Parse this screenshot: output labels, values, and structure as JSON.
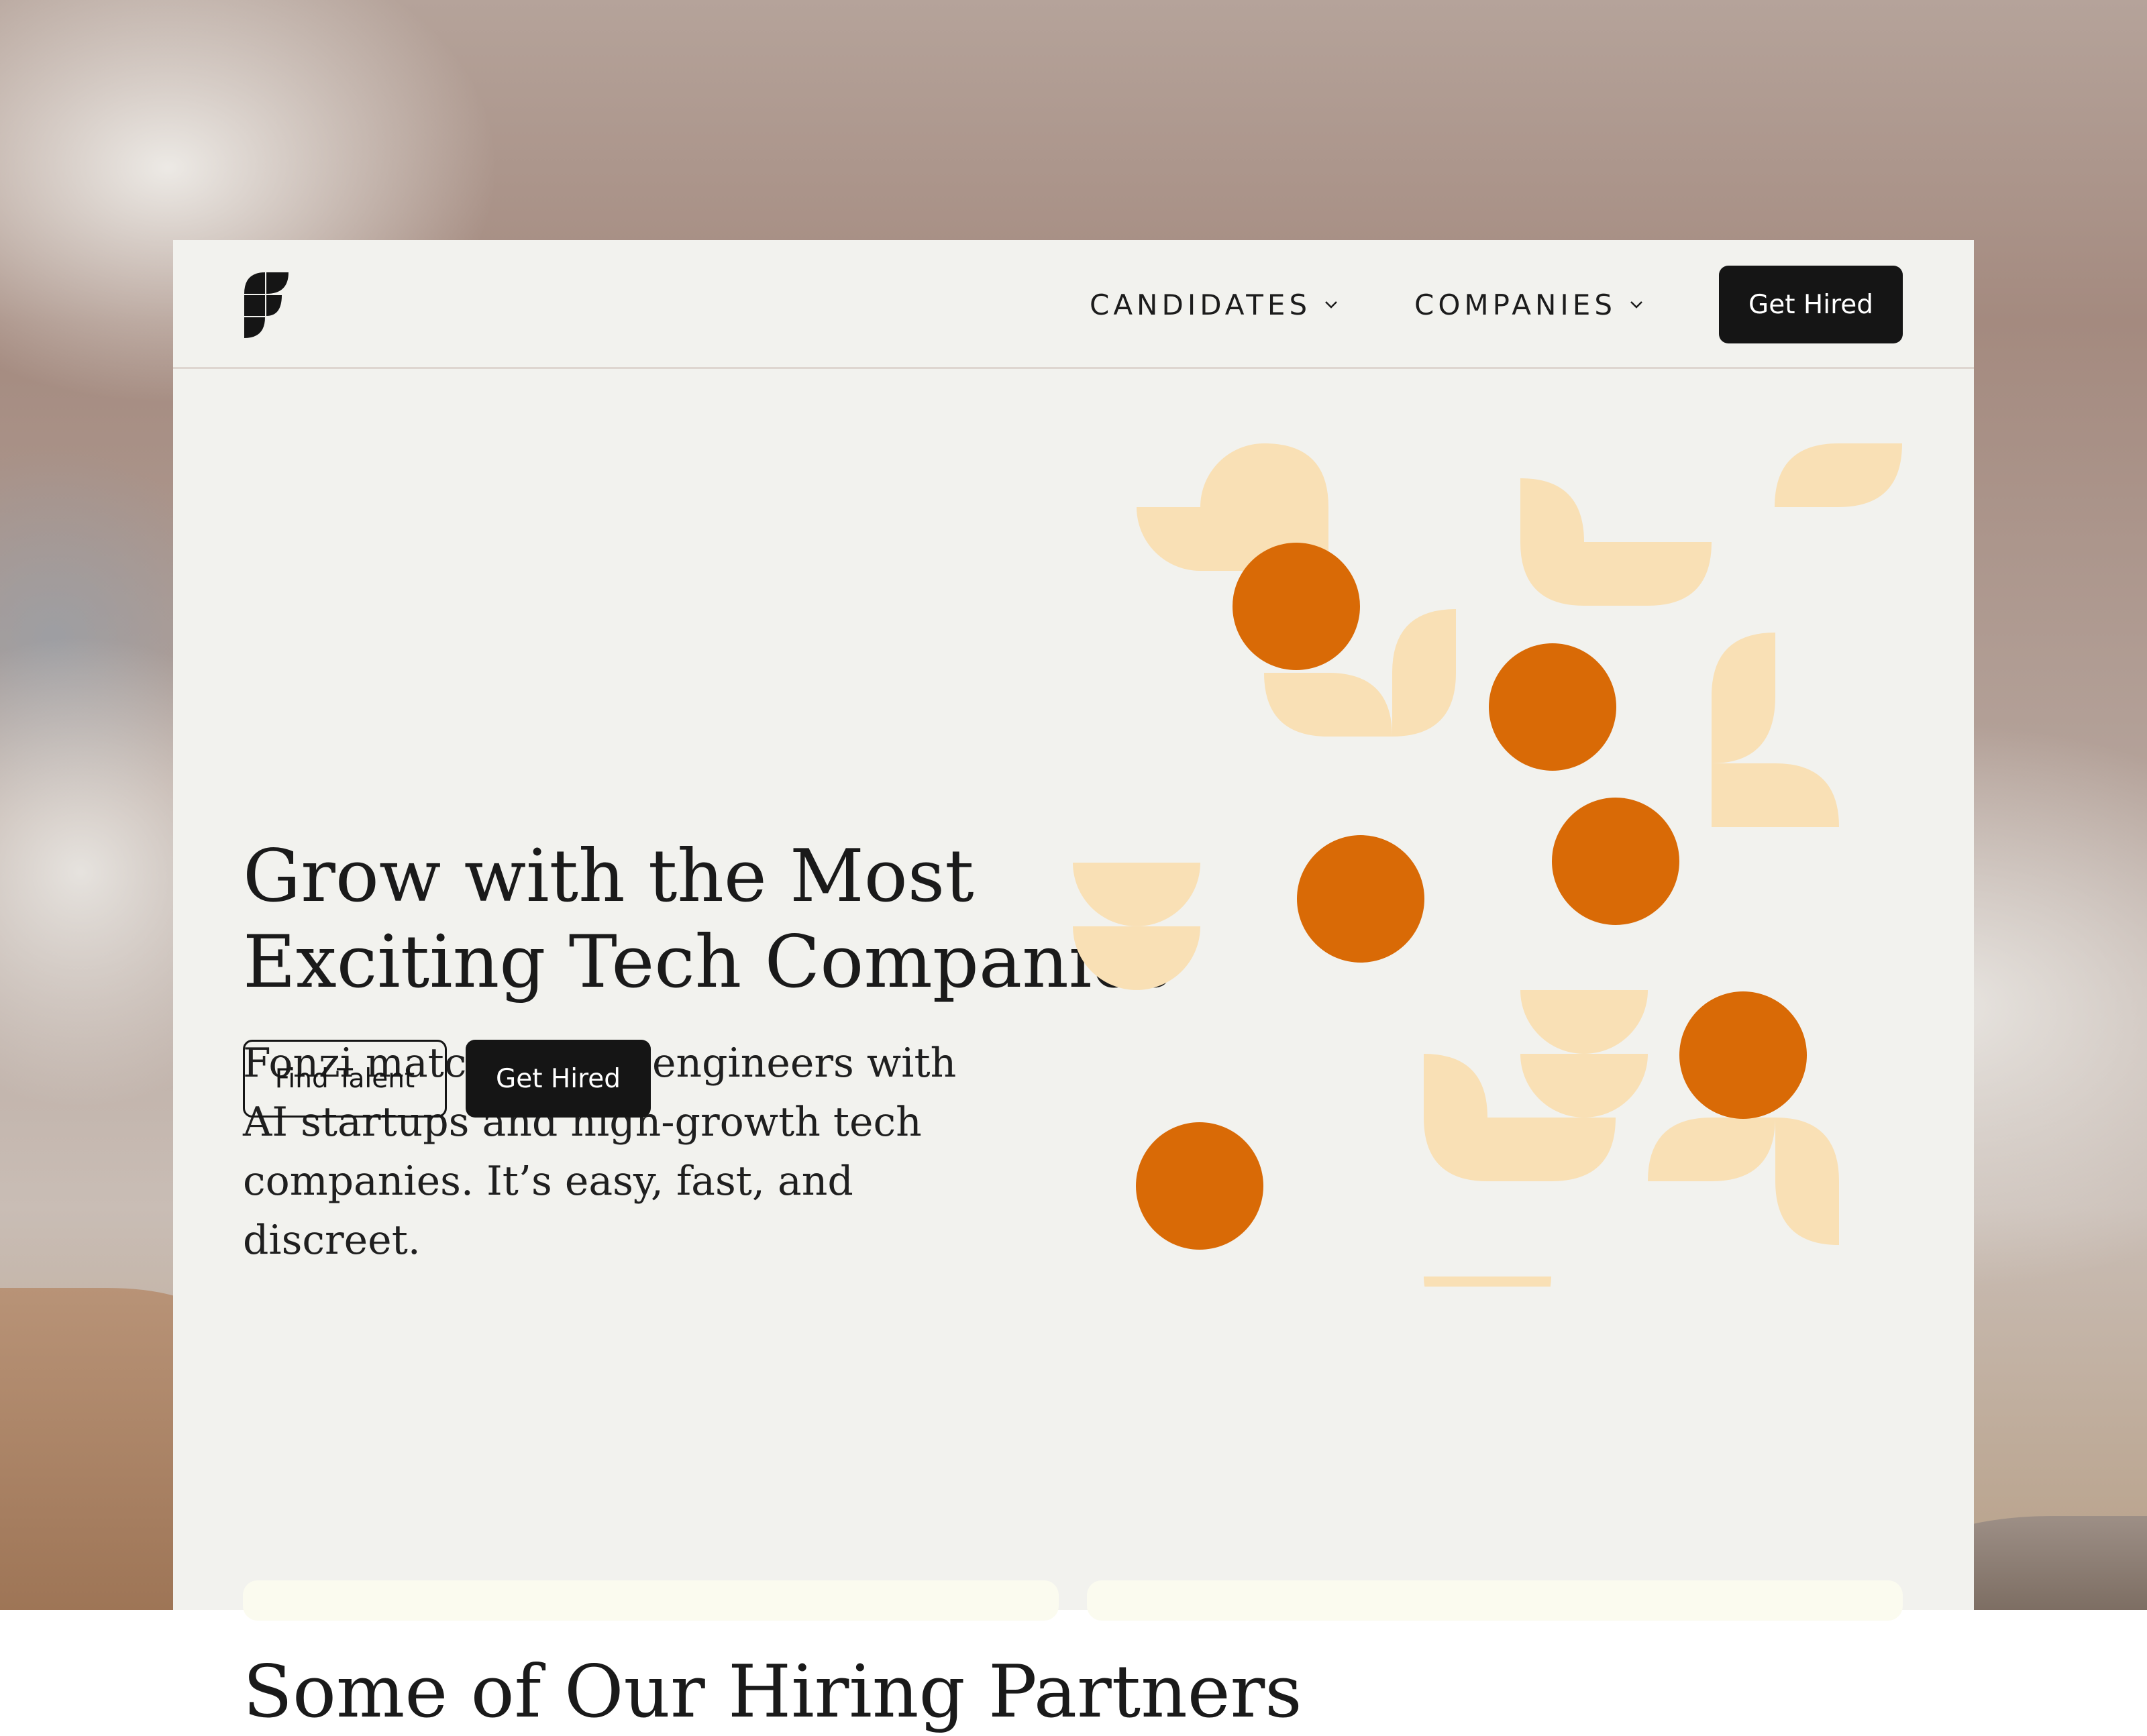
{
  "brand": {
    "logo": "fonzi-logo-icon"
  },
  "nav": {
    "items": [
      {
        "label": "CANDIDATES",
        "icon": "chevron-down-icon"
      },
      {
        "label": "COMPANIES",
        "icon": "chevron-down-icon"
      }
    ],
    "cta_label": "Get Hired"
  },
  "hero": {
    "title_line1": "Grow with the Most",
    "title_line2": "Exciting Tech Companies",
    "subtitle_line1": "Fonzi matches elite engineers with",
    "subtitle_line2": "AI startups and high-growth tech",
    "subtitle_line3": "companies. It’s easy, fast, and discreet.",
    "find_talent_label": "Find Talent",
    "get_hired_label": "Get Hired"
  },
  "partners": {
    "title": "Some of Our Hiring Partners"
  },
  "colors": {
    "page_bg": "#f2f2ee",
    "accent_orange": "#d96a06",
    "accent_peach": "#f9e0b5",
    "button_dark": "#151515"
  }
}
